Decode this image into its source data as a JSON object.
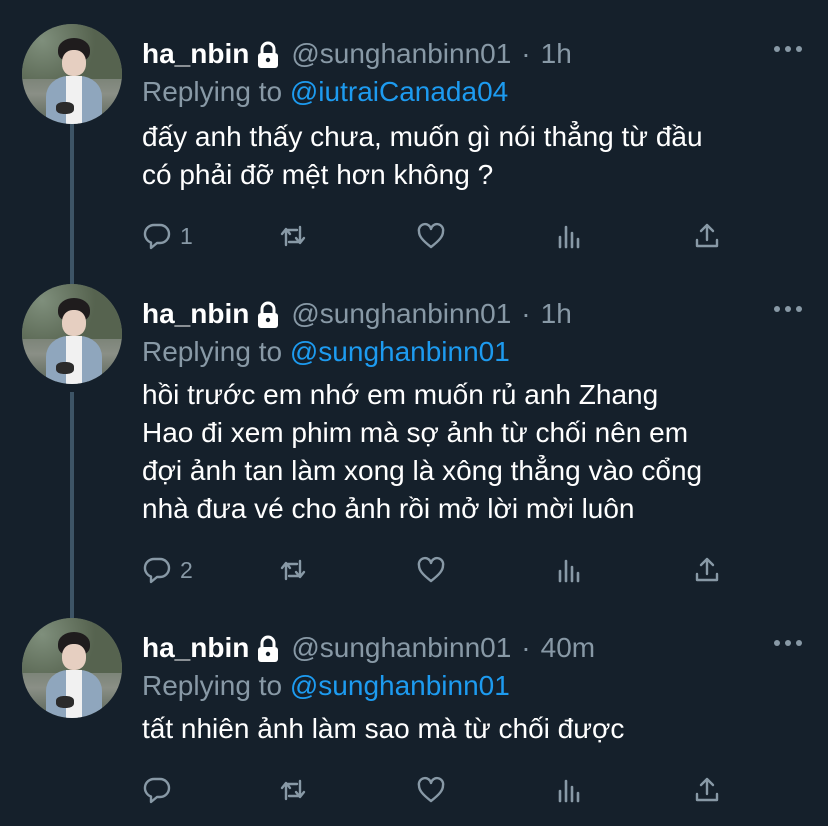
{
  "tweets": [
    {
      "name": "ha_nbin",
      "handle": "@sunghanbinn01",
      "separator": "·",
      "time": "1h",
      "replying_prefix": "Replying to",
      "replying_to": "@iutraiCanada04",
      "lines": [
        "đấy anh thấy chưa, muốn gì nói thẳng từ đầu",
        "có phải đỡ mệt hơn không ?"
      ],
      "reply_count": "1"
    },
    {
      "name": "ha_nbin",
      "handle": "@sunghanbinn01",
      "separator": "·",
      "time": "1h",
      "replying_prefix": "Replying to",
      "replying_to": "@sunghanbinn01",
      "lines": [
        "hồi trước em nhớ em muốn rủ anh Zhang",
        "Hao đi xem phim mà sợ ảnh từ chối nên em",
        "đợi ảnh tan làm xong là xông thẳng vào cổng",
        "nhà đưa vé cho ảnh rồi mở lời mời luôn"
      ],
      "reply_count": "2"
    },
    {
      "name": "ha_nbin",
      "handle": "@sunghanbinn01",
      "separator": "·",
      "time": "40m",
      "replying_prefix": "Replying to",
      "replying_to": "@sunghanbinn01",
      "lines": [
        "tất nhiên ảnh làm sao mà từ chối được"
      ],
      "reply_count": ""
    }
  ],
  "colors": {
    "background": "#15202b",
    "text": "#ffffff",
    "secondary": "#8899a6",
    "link": "#1d9bf0",
    "thread_line": "#3d5466"
  },
  "icons": [
    "lock-icon",
    "more-icon",
    "reply-icon",
    "retweet-icon",
    "like-icon",
    "analytics-icon",
    "share-icon"
  ]
}
